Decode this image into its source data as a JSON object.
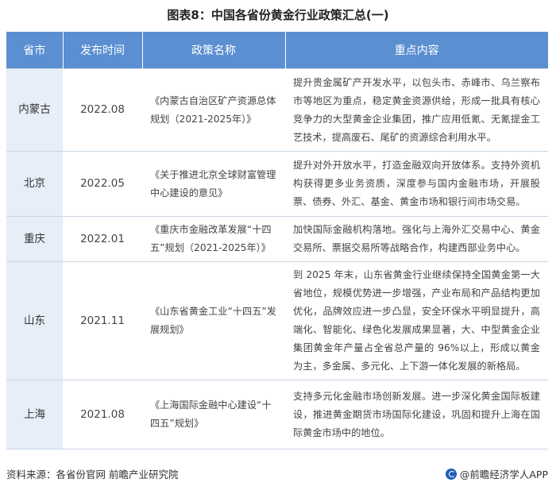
{
  "title": "图表8：中国各省份黄金行业政策汇总(一)",
  "table": {
    "headers": [
      "省市",
      "发布时间",
      "政策名称",
      "重点内容"
    ],
    "rows": [
      {
        "province": "内蒙古",
        "date": "2022.08",
        "policy": "《内蒙古自治区矿产资源总体规划（2021-2025年）》",
        "content": "提升贵金属矿产开发水平，以包头市、赤峰市、乌兰察布市等地区为重点，稳定黄金资源供给，形成一批具有核心竞争力的大型黄金企业集团，推广应用低氰、无氰提金工艺技术，提高废石、尾矿的资源综合利用水平。"
      },
      {
        "province": "北京",
        "date": "2022.05",
        "policy": "《关于推进北京全球财富管理中心建设的意见》",
        "content": "提升对外开放水平，打造金融双向开放体系。支持外资机构获得更多业务资质，深度参与国内金融市场，开展股票、债券、外汇、基金、黄金市场和银行间市场交易。"
      },
      {
        "province": "重庆",
        "date": "2022.01",
        "policy": "《重庆市金融改革发展“十四五”规划（2021-2025年）》",
        "content": "加快国际金融机构落地。强化与上海外汇交易中心、黄金交易所、票据交易所等战略合作，构建西部业务中心。"
      },
      {
        "province": "山东",
        "date": "2021.11",
        "policy": "《山东省黄金工业“十四五”发展规划》",
        "content": "到 2025 年末，山东省黄金行业继续保持全国黄金第一大省地位，规模优势进一步增强，产业布局和产品结构更加优化，品牌效应进一步凸显，安全环保水平明显提升，高端化、智能化、绿色化发展成果显著，大、中型黄金企业集团黄金年产量占全省总产量的 96%以上，形成以黄金为主，多金属、多元化、上下游一体化发展的新格局。"
      },
      {
        "province": "上海",
        "date": "2021.08",
        "policy": "《上海国际金融中心建设“十四五”规划》",
        "content": "支持多元化金融市场创新发展。进一步深化黄金国际板建设，推进黄金期货市场国际化建设，巩固和提升上海在国际黄金市场中的地位。"
      }
    ]
  },
  "footer": {
    "source": "资料来源：各省份官网 前瞻产业研究院",
    "brand": "@前瞻经济学人APP"
  }
}
